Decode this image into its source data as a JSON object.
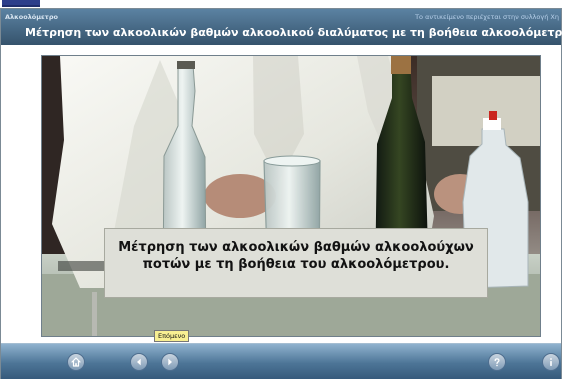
{
  "header": {
    "app_title": "Αλκοολόμετρο",
    "collection_info": "Το αντικείμενο περιέχεται στην συλλογή Χη",
    "page_title": "Μέτρηση των αλκοολικών βαθμών αλκοολικού διαλύματος με τη βοήθεια αλκοολόμετρου"
  },
  "video": {
    "caption_line1": "Μέτρηση των αλκοολικών βαθμών αλκοολούχων",
    "caption_line2": "ποτών με τη βοήθεια του αλκοολόμετρου."
  },
  "controls": {
    "tooltip": "Επόμενο",
    "buttons": [
      "home-icon",
      "previous-icon",
      "next-icon",
      "help-icon",
      "info-icon"
    ]
  },
  "colors": {
    "header_blue": "#35536c",
    "accent": "#2d3e8a",
    "control_bar": "#4d7597"
  }
}
